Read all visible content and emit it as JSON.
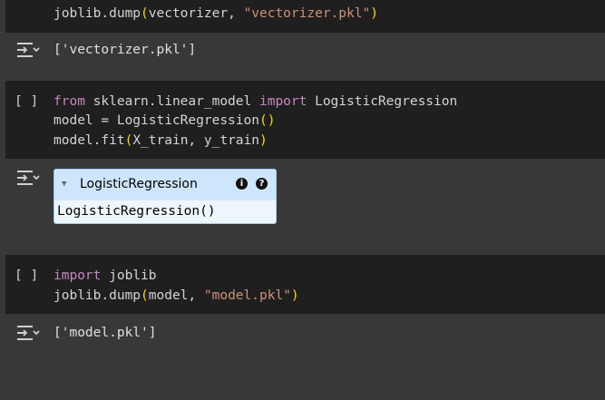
{
  "cells": [
    {
      "id": "cell-0",
      "code_lines": [
        [
          {
            "t": "joblib.dump",
            "c": "plain"
          },
          {
            "t": "(",
            "c": "par"
          },
          {
            "t": "vectorizer, ",
            "c": "plain"
          },
          {
            "t": "\"vectorizer.pkl\"",
            "c": "str"
          },
          {
            "t": ")",
            "c": "par"
          }
        ]
      ],
      "output": "['vectorizer.pkl']"
    },
    {
      "id": "cell-1",
      "run_label": "[ ]",
      "code_lines": [
        [
          {
            "t": "from ",
            "c": "kw"
          },
          {
            "t": "sklearn.linear_model ",
            "c": "plain"
          },
          {
            "t": "import ",
            "c": "kw"
          },
          {
            "t": "LogisticRegression",
            "c": "plain"
          }
        ],
        [
          {
            "t": "model = LogisticRegression",
            "c": "plain"
          },
          {
            "t": "()",
            "c": "par"
          }
        ],
        [
          {
            "t": "model.fit",
            "c": "plain"
          },
          {
            "t": "(",
            "c": "par"
          },
          {
            "t": "X_train, y_train",
            "c": "plain"
          },
          {
            "t": ")",
            "c": "par"
          }
        ]
      ],
      "widget": {
        "title": "LogisticRegression",
        "info_badge": "i",
        "help_badge": "?",
        "repr": "LogisticRegression()"
      }
    },
    {
      "id": "cell-2",
      "run_label": "[ ]",
      "code_lines": [
        [
          {
            "t": "import ",
            "c": "kw"
          },
          {
            "t": "joblib",
            "c": "plain"
          }
        ],
        [
          {
            "t": "joblib.dump",
            "c": "plain"
          },
          {
            "t": "(",
            "c": "par"
          },
          {
            "t": "model, ",
            "c": "plain"
          },
          {
            "t": "\"model.pkl\"",
            "c": "str"
          },
          {
            "t": ")",
            "c": "par"
          }
        ]
      ],
      "output": "['model.pkl']"
    }
  ],
  "colors": {
    "keyword": "#c586c0",
    "string": "#ce9178",
    "paren": "#ffd700",
    "cell_bg": "#1f1f1f",
    "page_bg": "#383838"
  },
  "icons": {
    "output_toggle": "output-collapse-icon",
    "widget_expand": "triangle-down-icon"
  }
}
